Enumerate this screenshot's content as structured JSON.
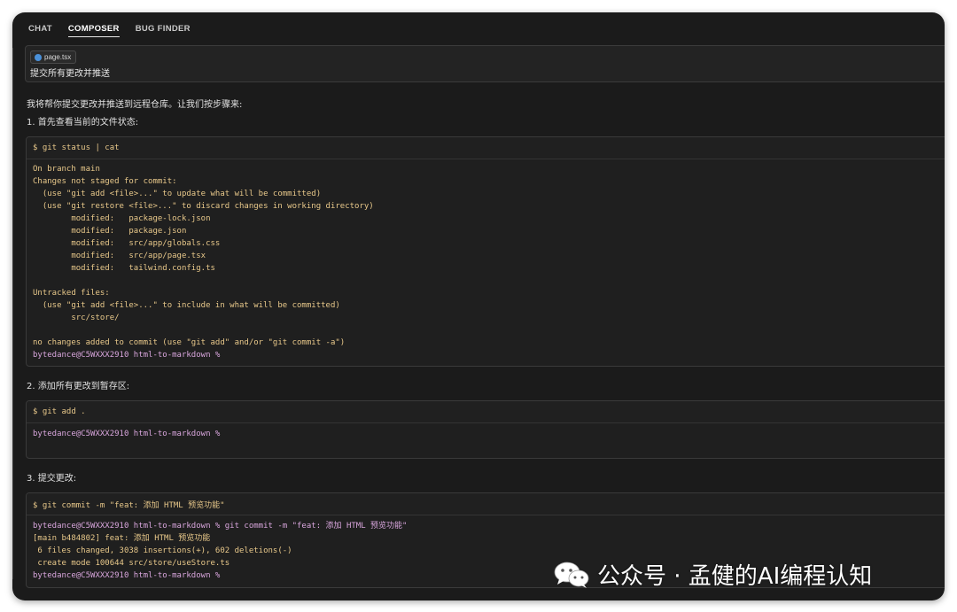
{
  "tabs": [
    "CHAT",
    "COMPOSER",
    "BUG FINDER"
  ],
  "active_tab": "COMPOSER",
  "prompt": {
    "file_chip": "page.tsx",
    "text": "提交所有更改并推送"
  },
  "messages": {
    "intro": "我将帮你提交更改并推送到远程仓库。让我们按步骤来:",
    "step1": "1. 首先查看当前的文件状态:",
    "step2": "2. 添加所有更改到暂存区:",
    "step3": "3. 提交更改:"
  },
  "blocks": {
    "status": {
      "command": "$ git status | cat",
      "lines": [
        "On branch main",
        "Changes not staged for commit:",
        "  (use \"git add <file>...\" to update what will be committed)",
        "  (use \"git restore <file>...\" to discard changes in working directory)",
        "        modified:   package-lock.json",
        "        modified:   package.json",
        "        modified:   src/app/globals.css",
        "        modified:   src/app/page.tsx",
        "        modified:   tailwind.config.ts",
        "",
        "Untracked files:",
        "  (use \"git add <file>...\" to include in what will be committed)",
        "        src/store/",
        "",
        "no changes added to commit (use \"git add\" and/or \"git commit -a\")"
      ],
      "prompt_line": "bytedance@C5WXXX2910 html-to-markdown %"
    },
    "add": {
      "command": "$ git add .",
      "prompt_line": "bytedance@C5WXXX2910 html-to-markdown %"
    },
    "commit": {
      "command": "$ git commit -m \"feat: 添加 HTML 预览功能\"",
      "echo_line": "bytedance@C5WXXX2910 html-to-markdown % git commit -m \"feat: 添加 HTML 预览功能\"",
      "lines": [
        "[main b484802] feat: 添加 HTML 预览功能",
        " 6 files changed, 3038 insertions(+), 602 deletions(-)",
        " create mode 100644 src/store/useStore.ts"
      ],
      "prompt_line": "bytedance@C5WXXX2910 html-to-markdown %"
    }
  },
  "watermark": {
    "text": "公众号 · 孟健的AI编程认知",
    "icon": "wechat-icon"
  },
  "colors": {
    "background": "#1b1b1b",
    "command_text": "#e8c88a",
    "prompt_text": "#d9a6dd"
  }
}
